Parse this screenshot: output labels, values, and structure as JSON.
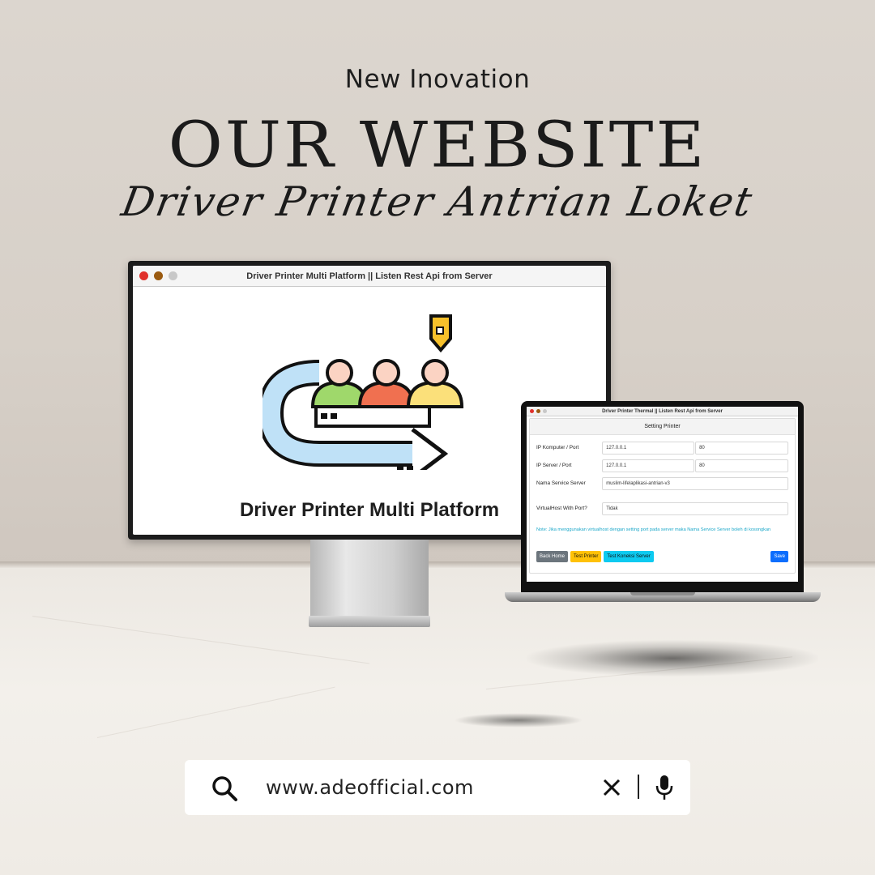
{
  "hero": {
    "kicker": "New Inovation",
    "headline": "OUR WEBSITE",
    "script_title": "Driver Printer Antrian Loket"
  },
  "desktop_app": {
    "window_title": "Driver Printer Multi Platform || Listen Rest Api from Server",
    "app_title": "Driver Printer Multi Platform",
    "traffic_lights": [
      "#e0302b",
      "#9a5a10",
      "#c8c8c8"
    ]
  },
  "laptop_app": {
    "window_title": "Driver Printer Thermal || Listen Rest Api from Server",
    "panel_title": "Setting Printer",
    "fields": {
      "ip_komputer": {
        "label": "IP Komputer / Port",
        "ip": "127.0.0.1",
        "port": "80"
      },
      "ip_server": {
        "label": "IP Server / Port",
        "ip": "127.0.0.1",
        "port": "80"
      },
      "service": {
        "label": "Nama Service Server",
        "value": "muslim-lifelaplikasi-antrian-v3"
      },
      "virtualhost": {
        "label": "VirtualHost With Port?",
        "value": "Tidak"
      }
    },
    "note": "Note: Jika menggunakan virtualhost dengan setting port pada server maka Nama Service Server boleh di kosongkan",
    "buttons": {
      "back_home": "Back Home",
      "test_printer": "Test Printer",
      "test_koneksi": "Test Koneksi Server",
      "save": "Save"
    },
    "colors": {
      "back": "#6c757d",
      "test_printer": "#ffc107",
      "test_koneksi": "#0dcaf0",
      "save": "#0d6efd"
    }
  },
  "search": {
    "value": "www.adeofficial.com",
    "icons": [
      "search-icon",
      "close-icon",
      "microphone-icon"
    ]
  }
}
